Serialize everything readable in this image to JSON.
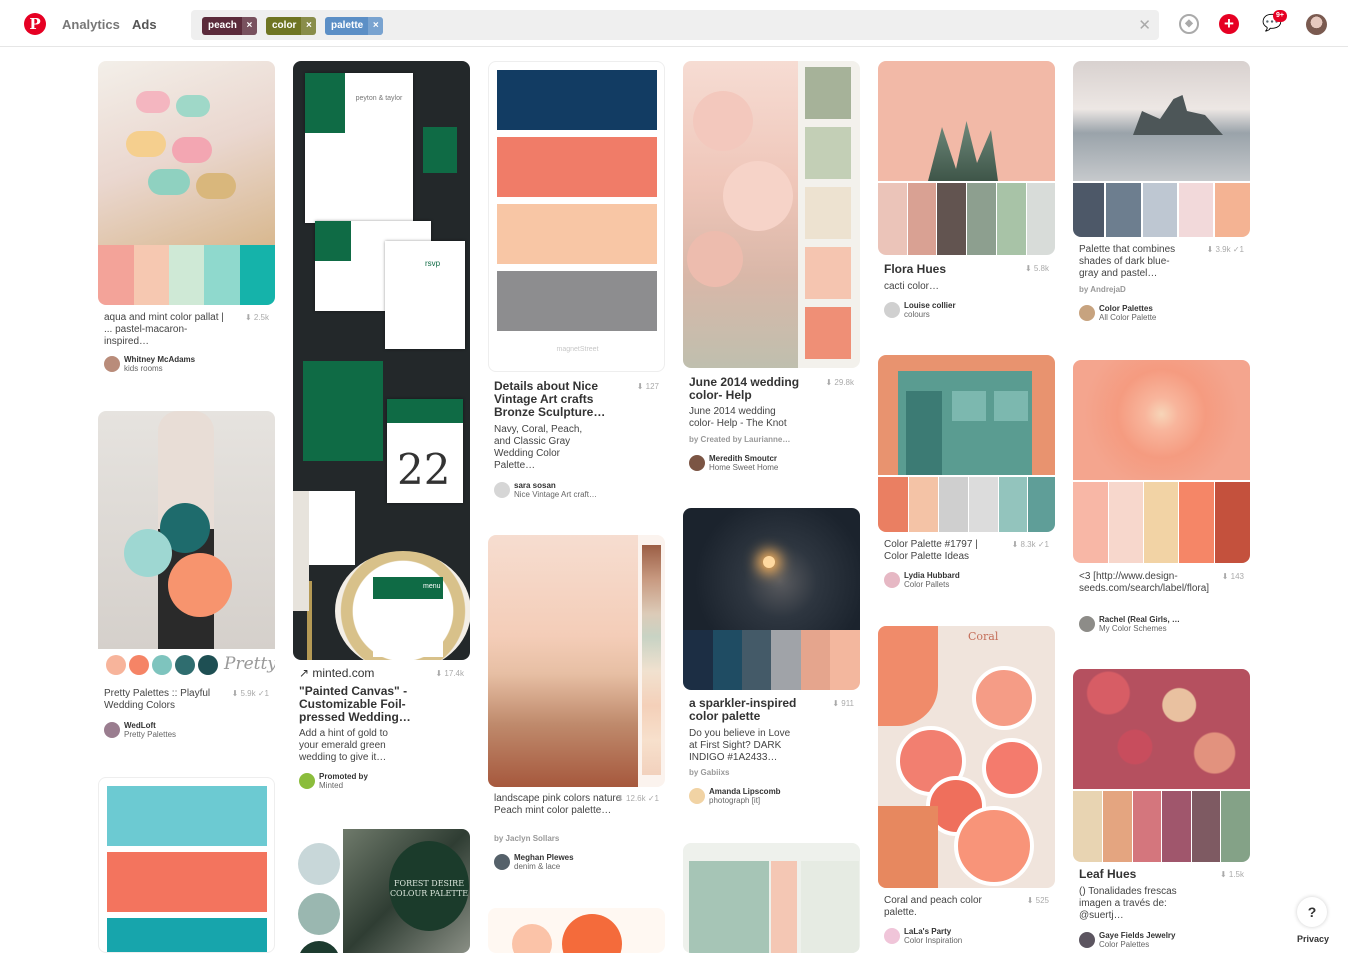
{
  "header": {
    "logo": "P",
    "nav_analytics": "Analytics",
    "nav_ads": "Ads",
    "tags": [
      {
        "label": "peach",
        "color": "#5b2b3b"
      },
      {
        "label": "color",
        "color": "#6f7523"
      },
      {
        "label": "palette",
        "color": "#5c8fc6"
      }
    ],
    "tag_remove": "×",
    "clear": "✕",
    "explore": "◆",
    "add": "+",
    "chat": "💬",
    "badge": "9+"
  },
  "pins": [
    {
      "desc": "aqua and mint color pallat | ... pastel-macaron-inspired…",
      "stat": "⬇ 2.5k",
      "user": "Whitney McAdams",
      "board": "kids rooms"
    },
    {
      "desc": "Pretty Palettes :: Playful Wedding Colors",
      "stat": "⬇ 5.9k  ✓1",
      "user": "WedLoft",
      "board": "Pretty Palettes"
    },
    {
      "domain": "↗ minted.com",
      "stat": "⬇ 17.4k",
      "title": "\"Painted Canvas\" - Customizable Foil-pressed Wedding…",
      "desc": "Add a hint of gold to your emerald green wedding to give it…",
      "user": "Promoted by",
      "board": "Minted"
    },
    {
      "title": "Details about Nice Vintage Art crafts Bronze Sculpture…",
      "stat": "⬇ 127",
      "desc": "Navy, Coral, Peach, and Classic Gray Wedding Color Palette…",
      "user": "sara sosan",
      "board": "Nice Vintage Art craft…"
    },
    {
      "desc": "landscape pink colors nature Peach mint color palette…",
      "stat": "⬇ 12.6k  ✓1",
      "by": "by Jaclyn Sollars",
      "user": "Meghan Plewes",
      "board": "denim & lace"
    },
    {
      "title": "June 2014 wedding color- Help",
      "stat": "⬇ 29.8k",
      "desc": "June 2014 wedding color- Help - The Knot",
      "by": "by Created by Laurianne…",
      "user": "Meredith Smoutcr",
      "board": "Home Sweet Home"
    },
    {
      "title": "a sparkler-inspired color palette",
      "stat": "⬇ 911",
      "desc": "Do you believe in Love at First Sight? DARK INDIGO #1A2433…",
      "by": "by Gabiixs",
      "user": "Amanda Lipscomb",
      "board": "photograph [it]"
    },
    {
      "title": "Flora Hues",
      "stat": "⬇ 5.8k",
      "desc": "cacti color…",
      "user": "Louise collier",
      "board": "colours"
    },
    {
      "desc": "Color Palette #1797 | Color Palette Ideas",
      "stat": "⬇ 8.3k  ✓1",
      "user": "Lydia Hubbard",
      "board": "Color Pallets"
    },
    {
      "desc": "Coral and peach color palette.",
      "stat": "⬇ 525",
      "user": "LaLa's Party",
      "board": "Color Inspiration"
    },
    {
      "desc": "Palette that combines shades of dark blue-gray and pastel…",
      "stat": "⬇ 3.9k  ✓1",
      "by": "by AndrejaD",
      "user": "Color Palettes",
      "board": "All Color Palette"
    },
    {
      "desc": "<3 [http://www.design-seeds.com/search/label/flora]",
      "stat": "⬇ 143",
      "user": "Rachel (Real Girls, …",
      "board": "My Color Schemes"
    },
    {
      "title": "Leaf Hues",
      "stat": "⬇ 1.5k",
      "desc": "() Tonalidades frescas imagen a través de: @suertj…",
      "user": "Gaye Fields Jewelry",
      "board": "Color Palettes"
    }
  ],
  "img_text": {
    "brand_magnet": "magnetStreet",
    "invite_names": "peyton & taylor",
    "invite_number": "22",
    "invite_menu": "menu",
    "invite_rsvp": "rsvp",
    "pretty": "Pretty",
    "forest": "FOREST DESIRE COLOUR PALETTE",
    "coral_text": "Coral"
  },
  "footer": {
    "help": "?",
    "privacy": "Privacy"
  },
  "colors": {
    "accent": "#e60023"
  }
}
